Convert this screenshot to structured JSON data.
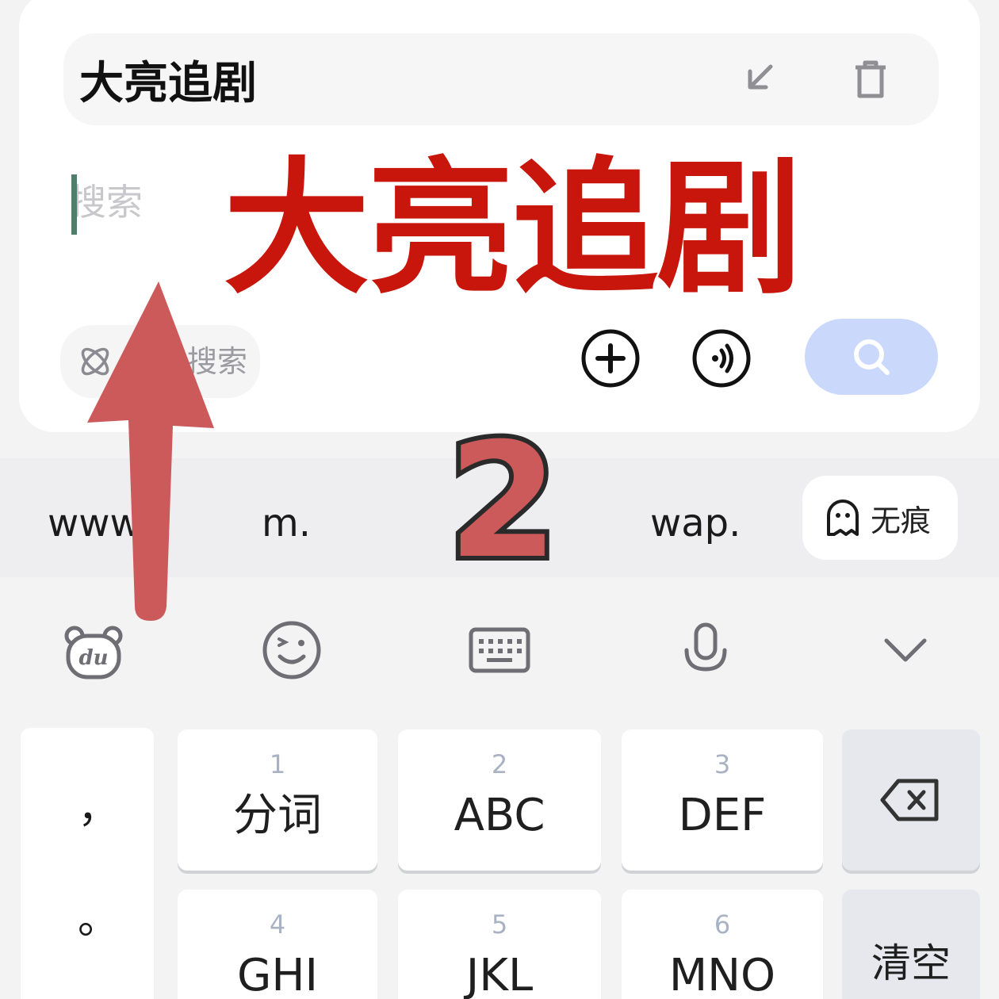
{
  "search_card": {
    "title": "大亮追剧",
    "search_placeholder": "搜索",
    "ai_search_label": "搜索",
    "icons": {
      "collapse": "arrow-down-left-icon",
      "delete": "trash-icon",
      "ai": "atom-icon",
      "add": "plus-circle-icon",
      "sound": "sound-wave-icon",
      "search": "search-icon"
    },
    "search_button_color": "#c9d8fb"
  },
  "overlay": {
    "big_label": "大亮追剧",
    "big_label_color": "#c8160c",
    "step_number": "2",
    "arrow_color": "#cd5a5a"
  },
  "suggestions": {
    "items": [
      "www.",
      "m.",
      "wap."
    ],
    "incognito_label": "无痕",
    "incognito_icon": "ghost-icon"
  },
  "toolbar": {
    "icons": [
      "du-bear-icon",
      "emoji-wink-icon",
      "keyboard-icon",
      "microphone-icon",
      "chevron-down-icon"
    ]
  },
  "keyboard": {
    "punctuation": [
      "，",
      "。"
    ],
    "keys": [
      {
        "num": "1",
        "letters": "分词"
      },
      {
        "num": "2",
        "letters": "ABC"
      },
      {
        "num": "3",
        "letters": "DEF"
      },
      {
        "num": "4",
        "letters": "GHI"
      },
      {
        "num": "5",
        "letters": "JKL"
      },
      {
        "num": "6",
        "letters": "MNO"
      }
    ],
    "delete_icon": "backspace-icon",
    "clear_label": "清空"
  }
}
